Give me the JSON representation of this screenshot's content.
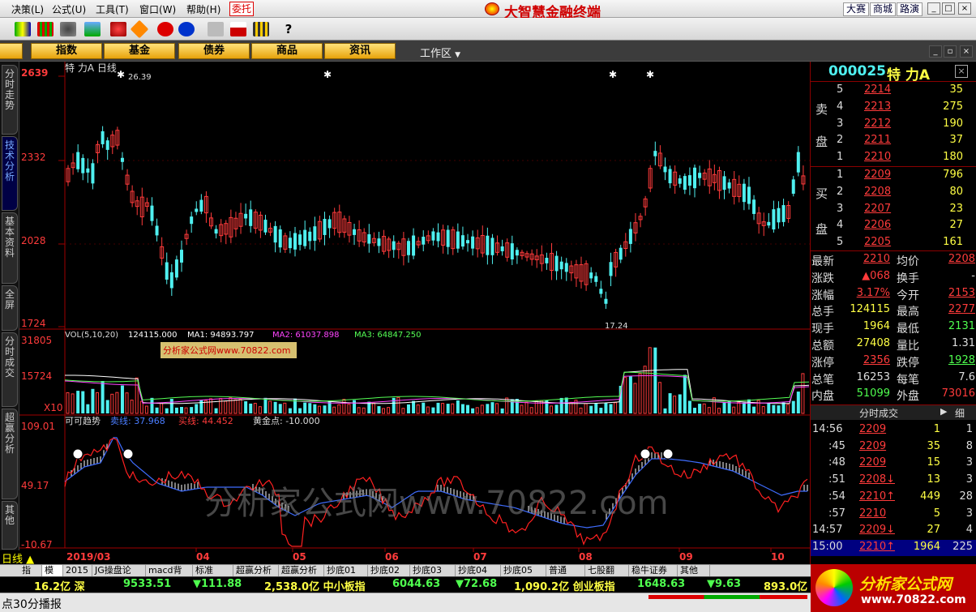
{
  "menu": [
    "决策(L)",
    "公式(U)",
    "工具(T)",
    "窗口(W)",
    "帮助(H)"
  ],
  "weituo": "委托",
  "brand": "大智慧金融终端",
  "top_links": [
    "大赛",
    "商城",
    "路演"
  ],
  "nav_buttons": [
    "股",
    "指数",
    "基金",
    "债券",
    "商品",
    "资讯"
  ],
  "workarea": "工作区",
  "left_tabs": [
    "分时走势",
    "技术分析",
    "基本资料",
    "全屏",
    "分时成交",
    "超赢分析",
    "其他"
  ],
  "chart": {
    "title": "特 力A 日线",
    "price_ticks": [
      "2639",
      "2332",
      "2028",
      "1724"
    ],
    "high_label": "26.39",
    "low_label": "17.24",
    "vol_legend": {
      "label": "VOL(5,10,20)",
      "v": "124115.000",
      "ma1": "MA1: 94893.797",
      "ma2": "MA2: 61037.898",
      "ma3": "MA3: 64847.250"
    },
    "vol_ticks": [
      "31805",
      "15724"
    ],
    "vol_mult": "X10",
    "watermark_box": "分析家公式网www.70822.com",
    "ind_legend": {
      "label": "可可趋势",
      "sell": "卖线: 37.968",
      "buy": "买线: 44.452",
      "gold": "黄金点: -10.000"
    },
    "ind_ticks": [
      "109.01",
      "49.17",
      "-10.67"
    ],
    "watermark": "分析家公式网www.70822.com",
    "months": [
      "2019/03",
      "04",
      "05",
      "06",
      "07",
      "08",
      "09",
      "10"
    ],
    "period": "日线"
  },
  "quote": {
    "code": "000025",
    "name": "特 力A",
    "sell_label": [
      "卖",
      "盘"
    ],
    "buy_label": [
      "买",
      "盘"
    ],
    "sell": [
      [
        "5",
        "2214",
        "35"
      ],
      [
        "4",
        "2213",
        "275"
      ],
      [
        "3",
        "2212",
        "190"
      ],
      [
        "2",
        "2211",
        "37"
      ],
      [
        "1",
        "2210",
        "180"
      ]
    ],
    "buy": [
      [
        "1",
        "2209",
        "796"
      ],
      [
        "2",
        "2208",
        "80"
      ],
      [
        "3",
        "2207",
        "23"
      ],
      [
        "4",
        "2206",
        "27"
      ],
      [
        "5",
        "2205",
        "161"
      ]
    ],
    "stats": [
      [
        "最新",
        "2210",
        "均价",
        "2208"
      ],
      [
        "涨跌",
        "▲068",
        "换手",
        "-"
      ],
      [
        "涨幅",
        "3.17%",
        "今开",
        "2153"
      ],
      [
        "总手",
        "124115",
        "最高",
        "2277"
      ],
      [
        "现手",
        "1964",
        "最低",
        "2131"
      ],
      [
        "总额",
        "27408",
        "量比",
        "1.31"
      ],
      [
        "涨停",
        "2356",
        "跌停",
        "1928"
      ],
      [
        "总笔",
        "16253",
        "每笔",
        "7.6"
      ],
      [
        "内盘",
        "51099",
        "外盘",
        "73016"
      ]
    ],
    "trades_title": "分时成交",
    "trades_btn": "细",
    "trades": [
      [
        "14:56",
        "2209",
        "1",
        "1"
      ],
      [
        ":45",
        "2209",
        "35",
        "8"
      ],
      [
        ":48",
        "2209",
        "15",
        "3"
      ],
      [
        ":51",
        "2208↓",
        "13",
        "3"
      ],
      [
        ":54",
        "2210↑",
        "449",
        "28"
      ],
      [
        ":57",
        "2210",
        "5",
        "3"
      ],
      [
        "14:57",
        "2209↓",
        "27",
        "4"
      ],
      [
        "15:00",
        "2210↑",
        "1964",
        "225"
      ]
    ]
  },
  "bottom_tabs": [
    "指标",
    "模板",
    "2015",
    "JG操盘论",
    "macd背离",
    "标准",
    "超赢分析",
    "超赢分析",
    "抄底01",
    "抄底02",
    "抄底03",
    "抄底04",
    "抄底05",
    "普通",
    "七股翻",
    "稳牛证券",
    "其他"
  ],
  "index_bar": [
    "16.2亿 深",
    "9533.51",
    "▼111.88",
    "2,538.0亿 中小板指",
    "6044.63",
    "▼72.68",
    "1,090.2亿 创业板指",
    "1648.63",
    "▼9.63",
    "893.0亿"
  ],
  "status": "点30分播报",
  "corner_logo": "分析家公式网",
  "corner_url": "www.70822.com",
  "colors": {
    "up": "#ff3b3b",
    "down": "#4ff0f0",
    "ma1": "#ffffff",
    "ma2": "#ff44ff",
    "ma3": "#55ff55",
    "yellow": "#ffff00"
  }
}
